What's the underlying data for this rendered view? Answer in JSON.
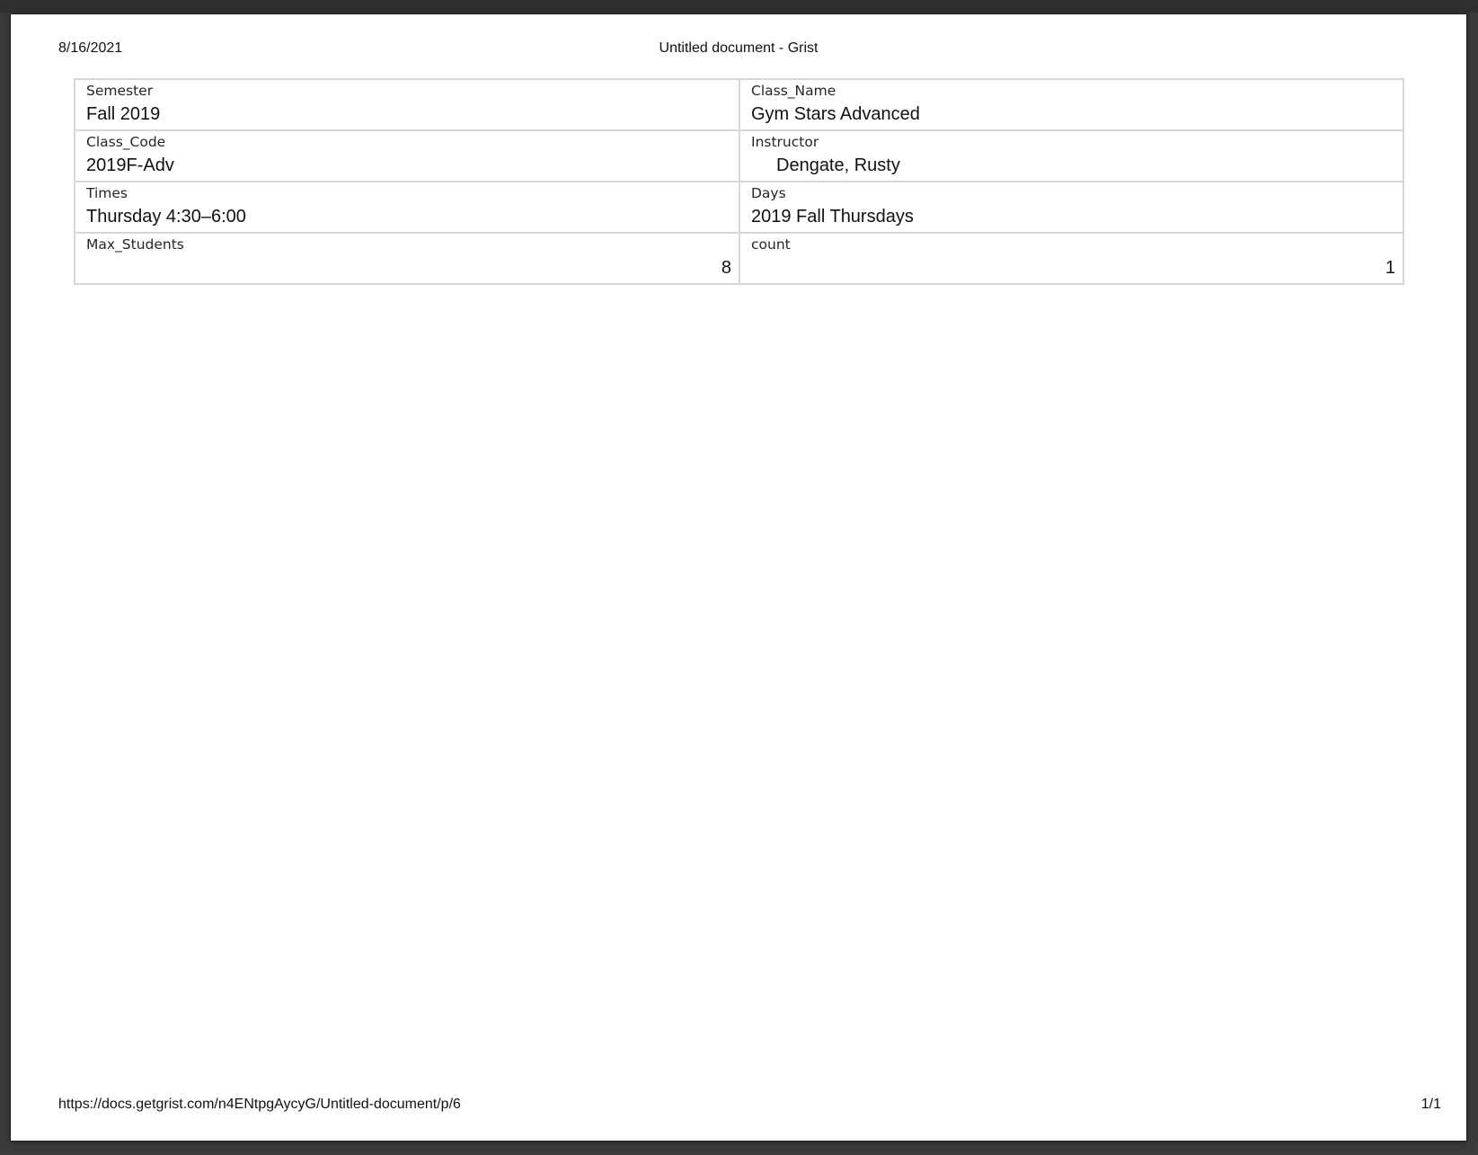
{
  "header": {
    "date": "8/16/2021",
    "title": "Untitled document - Grist"
  },
  "record": {
    "semester": {
      "label": "Semester",
      "value": "Fall 2019"
    },
    "class_name": {
      "label": "Class_Name",
      "value": "Gym Stars Advanced"
    },
    "class_code": {
      "label": "Class_Code",
      "value": "2019F-Adv"
    },
    "instructor": {
      "label": "Instructor",
      "value": "Dengate, Rusty"
    },
    "times": {
      "label": "Times",
      "value": "Thursday 4:30–6:00"
    },
    "days": {
      "label": "Days",
      "value": "2019 Fall Thursdays"
    },
    "max_students": {
      "label": "Max_Students",
      "value": "8"
    },
    "count": {
      "label": "count",
      "value": "1"
    }
  },
  "footer": {
    "url": "https://docs.getgrist.com/n4ENtpgAycyG/Untitled-document/p/6",
    "page": "1/1"
  }
}
